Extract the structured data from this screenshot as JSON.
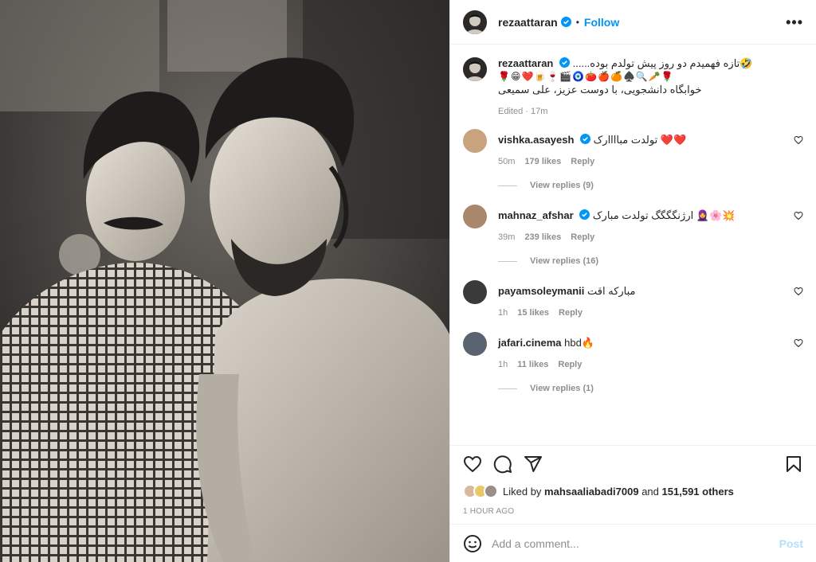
{
  "header": {
    "username": "rezaattaran",
    "separator": "•",
    "follow_label": "Follow",
    "more_label": "•••"
  },
  "caption": {
    "username": "rezaattaran",
    "text": "......تازه فهمیدم دو روز پیش تولدم بوده",
    "trailing_emoji": "🤣",
    "emoji_line": "🌹😁❤️🍺🍷🎬🧿🍅🍎🍊♠️🔍🥕🌹",
    "persian_line": "خوابگاه دانشجویی، با دوست عزیز، علی سمیعی",
    "meta": "Edited · 17m"
  },
  "comments": [
    {
      "username": "vishka.asayesh",
      "verified": true,
      "text": "تولدت مباااارک ❤️❤️",
      "time": "50m",
      "likes": "179 likes",
      "reply_label": "Reply",
      "view_replies": "View replies (9)",
      "avatar_color": "#c9a27e"
    },
    {
      "username": "mahnaz_afshar",
      "verified": true,
      "text": "ارژنگگگگ تولدت مبارک 🧕🌸💥",
      "time": "39m",
      "likes": "239 likes",
      "reply_label": "Reply",
      "view_replies": "View replies (16)",
      "avatar_color": "#a8876a"
    },
    {
      "username": "payamsoleymanii",
      "verified": false,
      "text": "مبارکه اقت",
      "time": "1h",
      "likes": "15 likes",
      "reply_label": "Reply",
      "view_replies": "",
      "avatar_color": "#3a3a3a"
    },
    {
      "username": "jafari.cinema",
      "verified": false,
      "text": "hbd🔥",
      "time": "1h",
      "likes": "11 likes",
      "reply_label": "Reply",
      "view_replies": "View replies (1)",
      "avatar_color": "#5a6470"
    }
  ],
  "likes": {
    "prefix": "Liked by",
    "user": "mahsaaliabadi7009",
    "and": "and",
    "others": "151,591 others"
  },
  "timestamp": "1 HOUR AGO",
  "add_comment": {
    "placeholder": "Add a comment...",
    "post_label": "Post"
  },
  "colors": {
    "accent": "#0095f6",
    "muted": "#8e8e8e",
    "post_disabled": "#b2dffc",
    "heart_red": "#ed4956"
  }
}
